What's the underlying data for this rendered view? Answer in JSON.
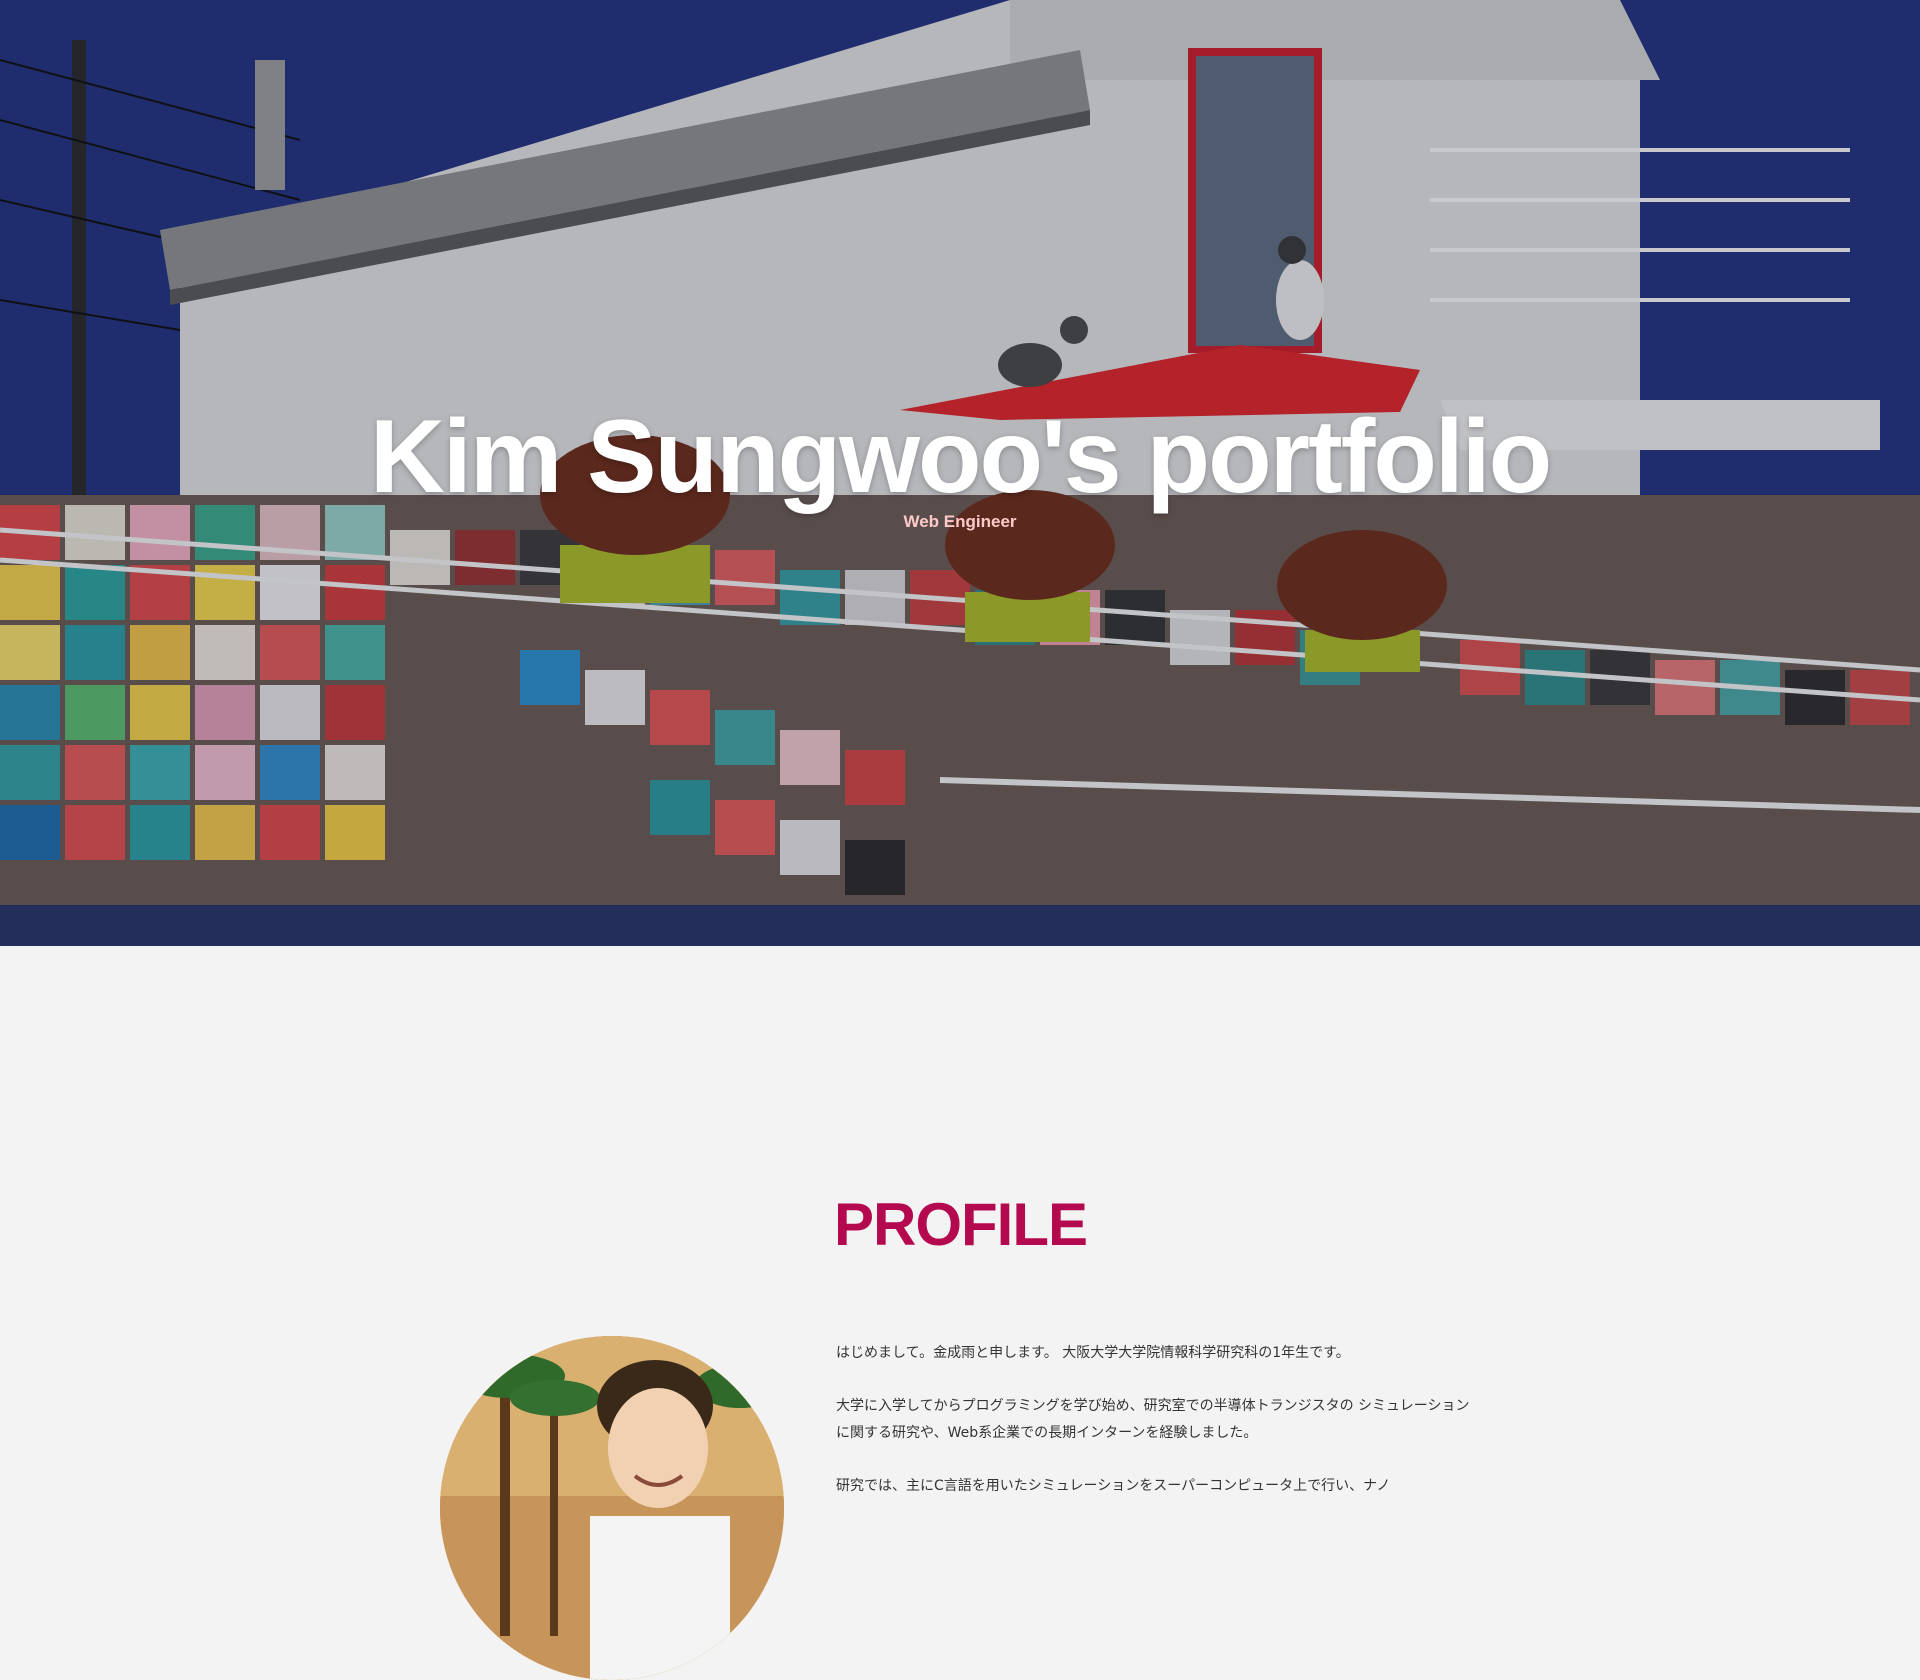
{
  "hero": {
    "title": "Kim Sungwoo's portfolio",
    "subtitle": "Web Engineer",
    "image": "cat-house-photo"
  },
  "profile": {
    "heading": "PROFILE",
    "avatar": "profile-photo",
    "paragraphs": [
      "はじめまして。金成雨と申します。 大阪大学大学院情報科学研究科の1年生です。",
      "大学に入学してからプログラミングを学び始め、研究室での半導体トランジスタの シミュレーションに関する研究や、Web系企業での長期インターンを経験しました。",
      "研究では、主にC言語を用いたシミュレーションをスーパーコンピュータ上で行い、ナノ"
    ]
  },
  "colors": {
    "accent": "#b5094f",
    "subtitle": "#ffc9c9",
    "sky": "#233585",
    "background": "#f3f3f3"
  }
}
